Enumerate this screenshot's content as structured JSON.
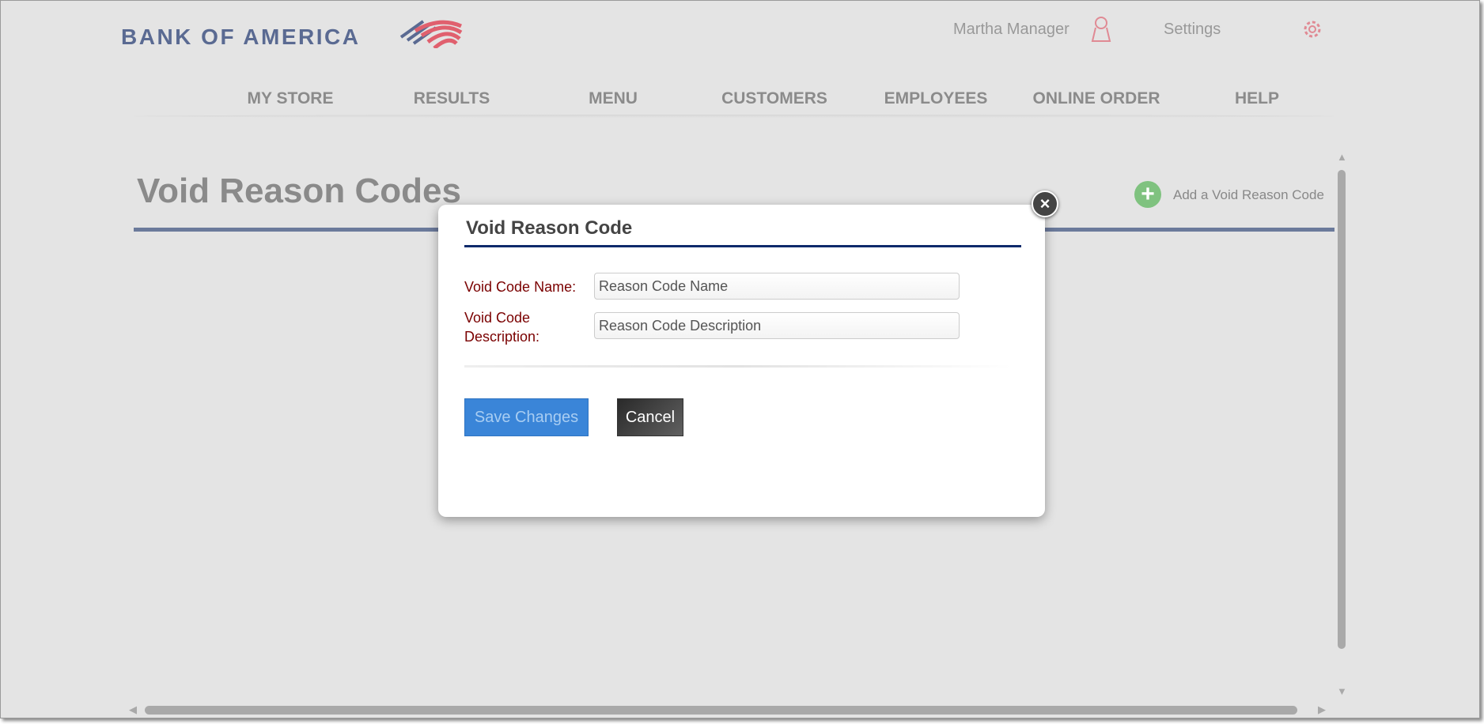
{
  "header": {
    "brand": "BANK OF AMERICA",
    "user_name": "Martha Manager",
    "settings_label": "Settings"
  },
  "nav": [
    "MY STORE",
    "RESULTS",
    "MENU",
    "CUSTOMERS",
    "EMPLOYEES",
    "ONLINE ORDER",
    "HELP"
  ],
  "page": {
    "title": "Void Reason Codes",
    "add_label": "Add a Void Reason Code"
  },
  "dialog": {
    "title": "Void Reason Code",
    "name_label": "Void Code Name:",
    "desc_label_1": "Void Code",
    "desc_label_2": "Description:",
    "name_placeholder": "Reason Code Name",
    "desc_placeholder": "Reason Code Description",
    "save_label": "Save Changes",
    "cancel_label": "Cancel",
    "close_icon": "×"
  },
  "colors": {
    "brand_blue": "#5a6a92",
    "brand_red": "#e0606e",
    "accent": "#3a85d8",
    "label": "#7a0000"
  }
}
